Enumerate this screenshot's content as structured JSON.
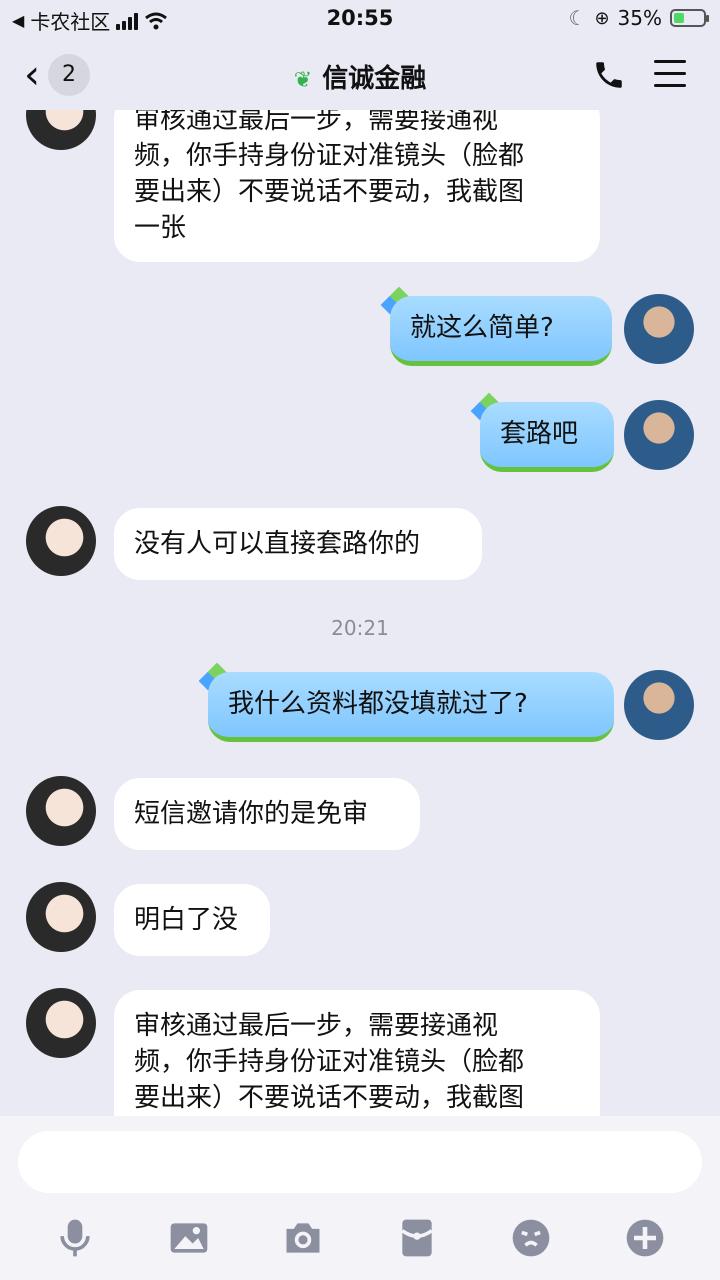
{
  "status_bar": {
    "carrier": "卡农社区",
    "time": "20:55",
    "battery": "35%",
    "battery_level": 0.35
  },
  "header": {
    "back_count": "2",
    "title": "信诚金融"
  },
  "messages": [
    {
      "from": "other",
      "text": "审核通过最后一步，需要接通视频，你手持身份证对准镜头（脸都要出来）不要说话不要动，我截图一张"
    },
    {
      "from": "me",
      "text": "就这么简单?"
    },
    {
      "from": "me",
      "text": "套路吧"
    },
    {
      "from": "other",
      "text": "没有人可以直接套路你的"
    },
    {
      "timestamp": "20:21"
    },
    {
      "from": "me",
      "text": "我什么资料都没填就过了?"
    },
    {
      "from": "other",
      "text": "短信邀请你的是免审"
    },
    {
      "from": "other",
      "text": "明白了没"
    },
    {
      "from": "other",
      "text": "审核通过最后一步，需要接通视频，你手持身份证对准镜头（脸都要出来）不要说话不要动，我截图"
    }
  ],
  "message_lines": {
    "m0": [
      "审核通过最后一步，需要接通视",
      "频，你手持身份证对准镜头（脸都",
      "要出来）不要说话不要动，我截图",
      "一张"
    ],
    "m8": [
      "审核通过最后一步，需要接通视",
      "频，你手持身份证对准镜头（脸都",
      "要出来）不要说话不要动，我截图"
    ]
  },
  "toolbar": {
    "icons": [
      "microphone-icon",
      "image-icon",
      "camera-icon",
      "red-packet-icon",
      "emoji-icon",
      "plus-icon"
    ]
  },
  "colors": {
    "background": "#eaeaf4",
    "my_bubble": "#8fcdff",
    "bubble_underline": "#66c13f"
  }
}
